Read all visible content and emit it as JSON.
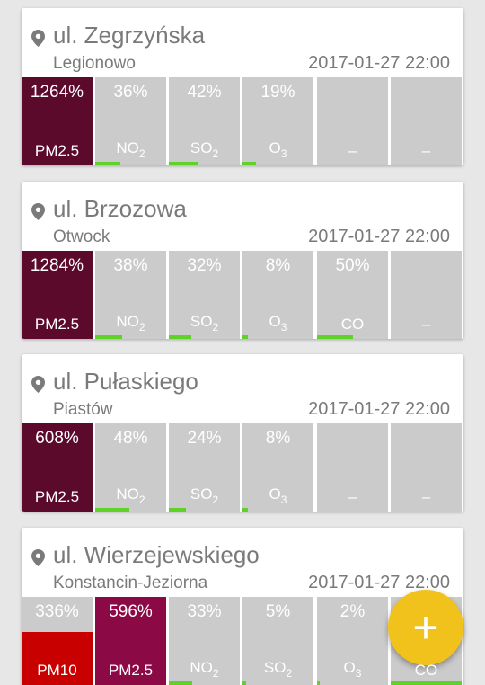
{
  "colors": {
    "background": "#e7e7e7",
    "tile_empty": "#cbcbcb",
    "severe": "#5b0a2b",
    "very_bad": "#8b0a45",
    "bad": "#c80000",
    "bar_good": "#5fd22a",
    "fab": "#f1c21b"
  },
  "stations": [
    {
      "street": "ul. Zegrzyńska",
      "city": "Legionowo",
      "time": "2017-01-27 22:00",
      "tiles": [
        {
          "value": "1264%",
          "name": "PM2.5",
          "sub": "",
          "fill": 1.0,
          "color": "#5b0a2b"
        },
        {
          "value": "36%",
          "name": "NO",
          "sub": "2",
          "fill": 0.36,
          "color": "#5fd22a"
        },
        {
          "value": "42%",
          "name": "SO",
          "sub": "2",
          "fill": 0.42,
          "color": "#5fd22a"
        },
        {
          "value": "19%",
          "name": "O",
          "sub": "3",
          "fill": 0.19,
          "color": "#5fd22a"
        },
        {
          "value": "",
          "name": "–",
          "sub": "",
          "fill": 0,
          "color": "#cbcbcb"
        },
        {
          "value": "",
          "name": "–",
          "sub": "",
          "fill": 0,
          "color": "#cbcbcb"
        }
      ]
    },
    {
      "street": "ul. Brzozowa",
      "city": "Otwock",
      "time": "2017-01-27 22:00",
      "tiles": [
        {
          "value": "1284%",
          "name": "PM2.5",
          "sub": "",
          "fill": 1.0,
          "color": "#5b0a2b"
        },
        {
          "value": "38%",
          "name": "NO",
          "sub": "2",
          "fill": 0.38,
          "color": "#5fd22a"
        },
        {
          "value": "32%",
          "name": "SO",
          "sub": "2",
          "fill": 0.32,
          "color": "#5fd22a"
        },
        {
          "value": "8%",
          "name": "O",
          "sub": "3",
          "fill": 0.08,
          "color": "#5fd22a"
        },
        {
          "value": "50%",
          "name": "CO",
          "sub": "",
          "fill": 0.5,
          "color": "#5fd22a"
        },
        {
          "value": "",
          "name": "–",
          "sub": "",
          "fill": 0,
          "color": "#cbcbcb"
        }
      ]
    },
    {
      "street": "ul. Pułaskiego",
      "city": "Piastów",
      "time": "2017-01-27 22:00",
      "tiles": [
        {
          "value": "608%",
          "name": "PM2.5",
          "sub": "",
          "fill": 1.0,
          "color": "#5b0a2b"
        },
        {
          "value": "48%",
          "name": "NO",
          "sub": "2",
          "fill": 0.48,
          "color": "#5fd22a"
        },
        {
          "value": "24%",
          "name": "SO",
          "sub": "2",
          "fill": 0.24,
          "color": "#5fd22a"
        },
        {
          "value": "8%",
          "name": "O",
          "sub": "3",
          "fill": 0.08,
          "color": "#5fd22a"
        },
        {
          "value": "",
          "name": "–",
          "sub": "",
          "fill": 0,
          "color": "#cbcbcb"
        },
        {
          "value": "",
          "name": "–",
          "sub": "",
          "fill": 0,
          "color": "#cbcbcb"
        }
      ]
    },
    {
      "street": "ul. Wierzejewskiego",
      "city": "Konstancin-Jeziorna",
      "time": "2017-01-27 22:00",
      "tiles": [
        {
          "value": "336%",
          "name": "PM10",
          "sub": "",
          "fill": 0.6,
          "color": "#c80000"
        },
        {
          "value": "596%",
          "name": "PM2.5",
          "sub": "",
          "fill": 1.0,
          "color": "#8b0a45"
        },
        {
          "value": "33%",
          "name": "NO",
          "sub": "2",
          "fill": 0.33,
          "color": "#5fd22a"
        },
        {
          "value": "5%",
          "name": "SO",
          "sub": "2",
          "fill": 0.05,
          "color": "#5fd22a"
        },
        {
          "value": "2%",
          "name": "O",
          "sub": "3",
          "fill": 0.02,
          "color": "#5fd22a"
        },
        {
          "value": "",
          "name": "CO",
          "sub": "",
          "fill": 0.5,
          "color": "#5fd22a"
        }
      ]
    }
  ],
  "fab": {
    "icon": "plus-icon",
    "glyph": "+"
  }
}
